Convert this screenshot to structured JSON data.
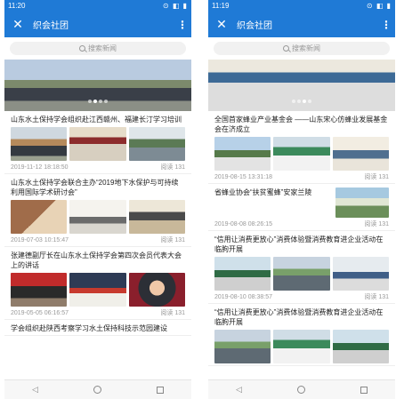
{
  "colors": {
    "accent": "#1f7ad6"
  },
  "left": {
    "status": {
      "time": "11:20",
      "icons": "⊙ ◧ ▮"
    },
    "title": "织会社团",
    "search_placeholder": "搜索新闻",
    "articles": [
      {
        "title": "山东水土保持学会组织赴江西赣州、福建长汀学习培训",
        "date": "2019-11-12 18:18:50",
        "reads": "阅读 131"
      },
      {
        "title": "山东水土保持学会联合主办“2019地下水保护与可持续利用国际学术研讨会”",
        "date": "2019-07-03 10:15:47",
        "reads": "阅读 131"
      },
      {
        "title": "张建德副厅长在山东水土保持学会第四次会员代表大会上的讲话",
        "date": "2019-05-05 06:16:57",
        "reads": "阅读 131"
      },
      {
        "title": "学会组织赴陕西考察学习水土保持科技示范园建设",
        "date": "",
        "reads": ""
      }
    ]
  },
  "right": {
    "status": {
      "time": "11:19",
      "icons": "⊙ ◧ ▮"
    },
    "title": "织会社团",
    "search_placeholder": "搜索新闻",
    "articles": [
      {
        "title": "全国首家蜂业产业基金会 ——山东宋心仿蜂业发展基金会在济成立",
        "date": "2019-08-15 13:31:18",
        "reads": "阅读 131"
      },
      {
        "title": "省蜂业协会“扶贫蜜蜂”安家兰陵",
        "date": "2019-08-08 08:26:15",
        "reads": "阅读 131"
      },
      {
        "title": "“信用让消费更放心”消费体验暨消费教育进企业活动在临朐开展",
        "date": "2019-08-10 08:38:57",
        "reads": "阅读 131"
      },
      {
        "title": "“信用让消费更放心”消费体验暨消费教育进企业活动在临朐开展",
        "date": "",
        "reads": ""
      }
    ]
  }
}
